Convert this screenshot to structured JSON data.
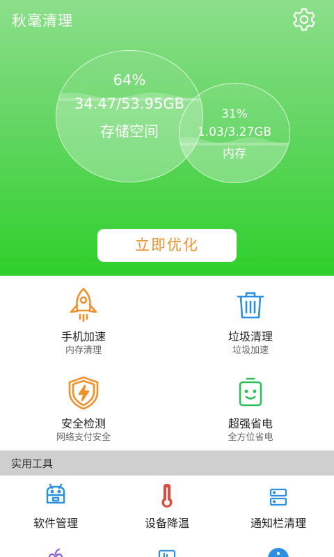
{
  "header": {
    "title": "秋毫清理",
    "settings_icon": "gear-icon"
  },
  "storage": {
    "percent": "64%",
    "usage": "34.47/53.95GB",
    "label": "存储空间",
    "fill_fraction": 0.64
  },
  "memory": {
    "percent": "31%",
    "usage": "1.03/3.27GB",
    "label": "内存",
    "fill_fraction": 0.31
  },
  "optimize_label": "立即优化",
  "features": [
    {
      "title": "手机加速",
      "sub": "内存清理",
      "icon": "rocket-icon",
      "color": "#f0902a"
    },
    {
      "title": "垃圾清理",
      "sub": "垃圾加速",
      "icon": "trash-icon",
      "color": "#2a8fe0"
    },
    {
      "title": "安全检测",
      "sub": "网络支付安全",
      "icon": "shield-icon",
      "color": "#f0902a"
    },
    {
      "title": "超强省电",
      "sub": "全方位省电",
      "icon": "battery-icon",
      "color": "#2fbf5a"
    }
  ],
  "tools_section": {
    "title": "实用工具"
  },
  "tools": [
    {
      "label": "软件管理",
      "icon": "android-icon",
      "color": "#2a8fe0"
    },
    {
      "label": "设备降温",
      "icon": "thermometer-icon",
      "color": "#e0493a"
    },
    {
      "label": "通知栏清理",
      "icon": "notification-icon",
      "color": "#2a8fe0"
    }
  ],
  "colors": {
    "brand_green": "#2fcf2a",
    "accent_orange": "#f0902a",
    "accent_blue": "#2a8fe0"
  }
}
